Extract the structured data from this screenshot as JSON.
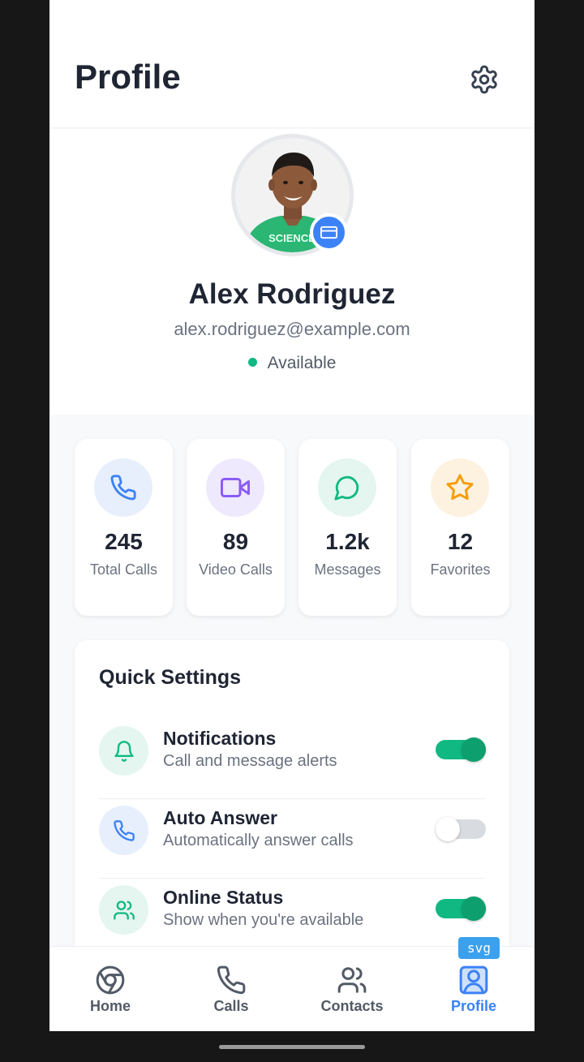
{
  "header": {
    "title": "Profile",
    "settings_icon": "gear-icon"
  },
  "profile": {
    "name": "Alex Rodriguez",
    "email": "alex.rodriguez@example.com",
    "status": "Available",
    "status_color": "#10b981",
    "avatar_badge_icon": "card-icon",
    "avatar_shirt_text": "SCIENCE"
  },
  "stats": [
    {
      "value": "245",
      "label": "Total Calls",
      "icon": "phone-icon",
      "color": "#3b82f6",
      "bg": "#e7effd"
    },
    {
      "value": "89",
      "label": "Video Calls",
      "icon": "video-icon",
      "color": "#8b5cf6",
      "bg": "#efe9fd"
    },
    {
      "value": "1.2k",
      "label": "Messages",
      "icon": "message-icon",
      "color": "#10b981",
      "bg": "#e4f6ef"
    },
    {
      "value": "12",
      "label": "Favorites",
      "icon": "star-icon",
      "color": "#f59e0b",
      "bg": "#fdf1e0"
    }
  ],
  "quick_settings": {
    "title": "Quick Settings",
    "items": [
      {
        "label": "Notifications",
        "description": "Call and message alerts",
        "icon": "bell-icon",
        "enabled": true
      },
      {
        "label": "Auto Answer",
        "description": "Automatically answer calls",
        "icon": "phone-icon",
        "enabled": false
      },
      {
        "label": "Online Status",
        "description": "Show when you're available",
        "icon": "users-icon",
        "enabled": true
      }
    ]
  },
  "nav": {
    "items": [
      {
        "label": "Home",
        "icon": "chrome-icon",
        "active": false
      },
      {
        "label": "Calls",
        "icon": "phone-icon",
        "active": false
      },
      {
        "label": "Contacts",
        "icon": "users-icon",
        "active": false
      },
      {
        "label": "Profile",
        "icon": "user-icon",
        "active": true
      }
    ],
    "active_color": "#3b82f6",
    "debug_tag": "svg"
  }
}
